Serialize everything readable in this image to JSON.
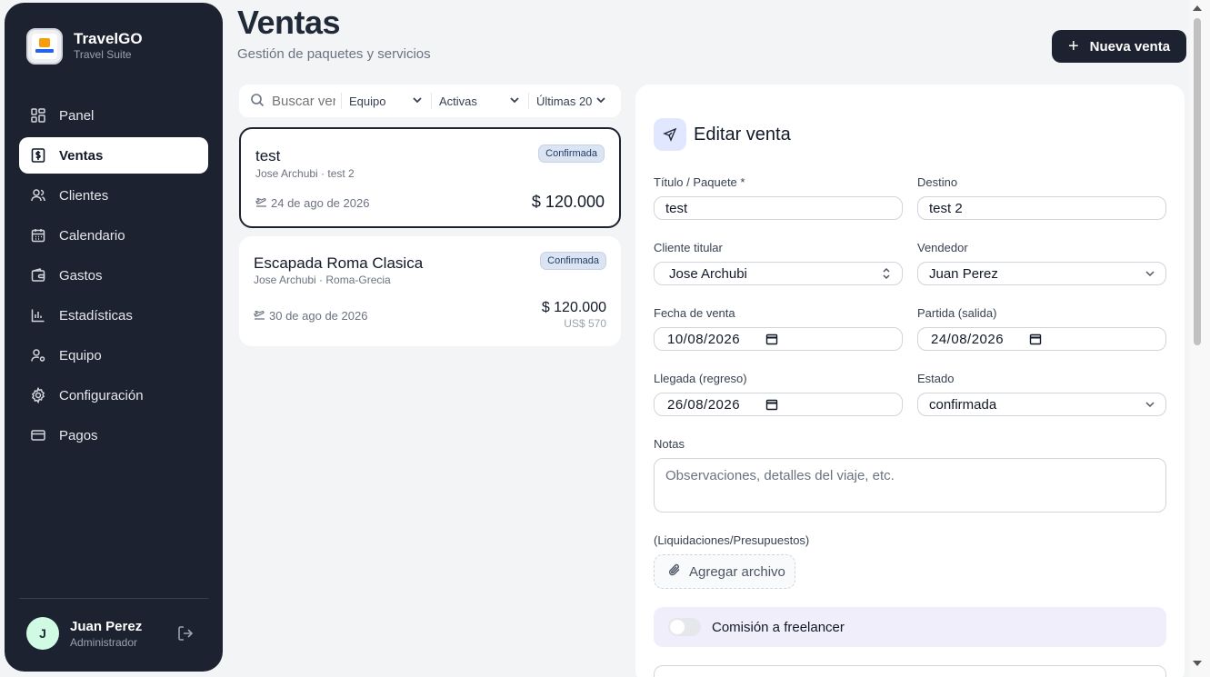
{
  "brand": {
    "name": "TravelGO",
    "subtitle": "Travel Suite"
  },
  "sidebar": {
    "items": [
      {
        "label": "Panel",
        "icon": "dashboard-icon"
      },
      {
        "label": "Ventas",
        "icon": "dollar-icon",
        "active": true
      },
      {
        "label": "Clientes",
        "icon": "users-icon"
      },
      {
        "label": "Calendario",
        "icon": "calendar-icon"
      },
      {
        "label": "Gastos",
        "icon": "wallet-icon"
      },
      {
        "label": "Estadísticas",
        "icon": "bar-chart-icon"
      },
      {
        "label": "Equipo",
        "icon": "user-gear-icon"
      },
      {
        "label": "Configuración",
        "icon": "gear-icon"
      },
      {
        "label": "Pagos",
        "icon": "credit-card-icon"
      }
    ]
  },
  "user": {
    "initial": "J",
    "name": "Juan Perez",
    "role": "Administrador"
  },
  "header": {
    "title": "Ventas",
    "subtitle": "Gestión de paquetes y servicios",
    "new_button": "Nueva venta"
  },
  "filters": {
    "search_placeholder": "Buscar ventas",
    "team": "Equipo",
    "status": "Activas",
    "range": "Últimas 20"
  },
  "sales": [
    {
      "title": "test",
      "subtitle": "Jose Archubi · test 2",
      "badge": "Confirmada",
      "date": "24 de ago de 2026",
      "price": "$ 120.000",
      "usd": ""
    },
    {
      "title": "Escapada Roma Clasica",
      "subtitle": "Jose Archubi · Roma-Grecia",
      "badge": "Confirmada",
      "date": "30 de ago de 2026",
      "price": "$ 120.000",
      "usd": "US$ 570"
    }
  ],
  "form": {
    "title": "Editar venta",
    "titulo_label": "Título / Paquete *",
    "titulo_value": "test",
    "destino_label": "Destino",
    "destino_value": "test 2",
    "cliente_label": "Cliente titular",
    "cliente_value": "Jose Archubi",
    "vendedor_label": "Vendedor",
    "vendedor_value": "Juan Perez",
    "fecha_label": "Fecha de venta",
    "fecha_value": "10/08/2026",
    "partida_label": "Partida (salida)",
    "partida_value": "24/08/2026",
    "llegada_label": "Llegada (regreso)",
    "llegada_value": "26/08/2026",
    "estado_label": "Estado",
    "estado_value": "confirmada",
    "notas_label": "Notas",
    "notas_placeholder": "Observaciones, detalles del viaje, etc.",
    "archivos_label": "(Liquidaciones/Presupuestos)",
    "attach_button": "Agregar archivo",
    "freelancer_label": "Comisión a freelancer"
  }
}
